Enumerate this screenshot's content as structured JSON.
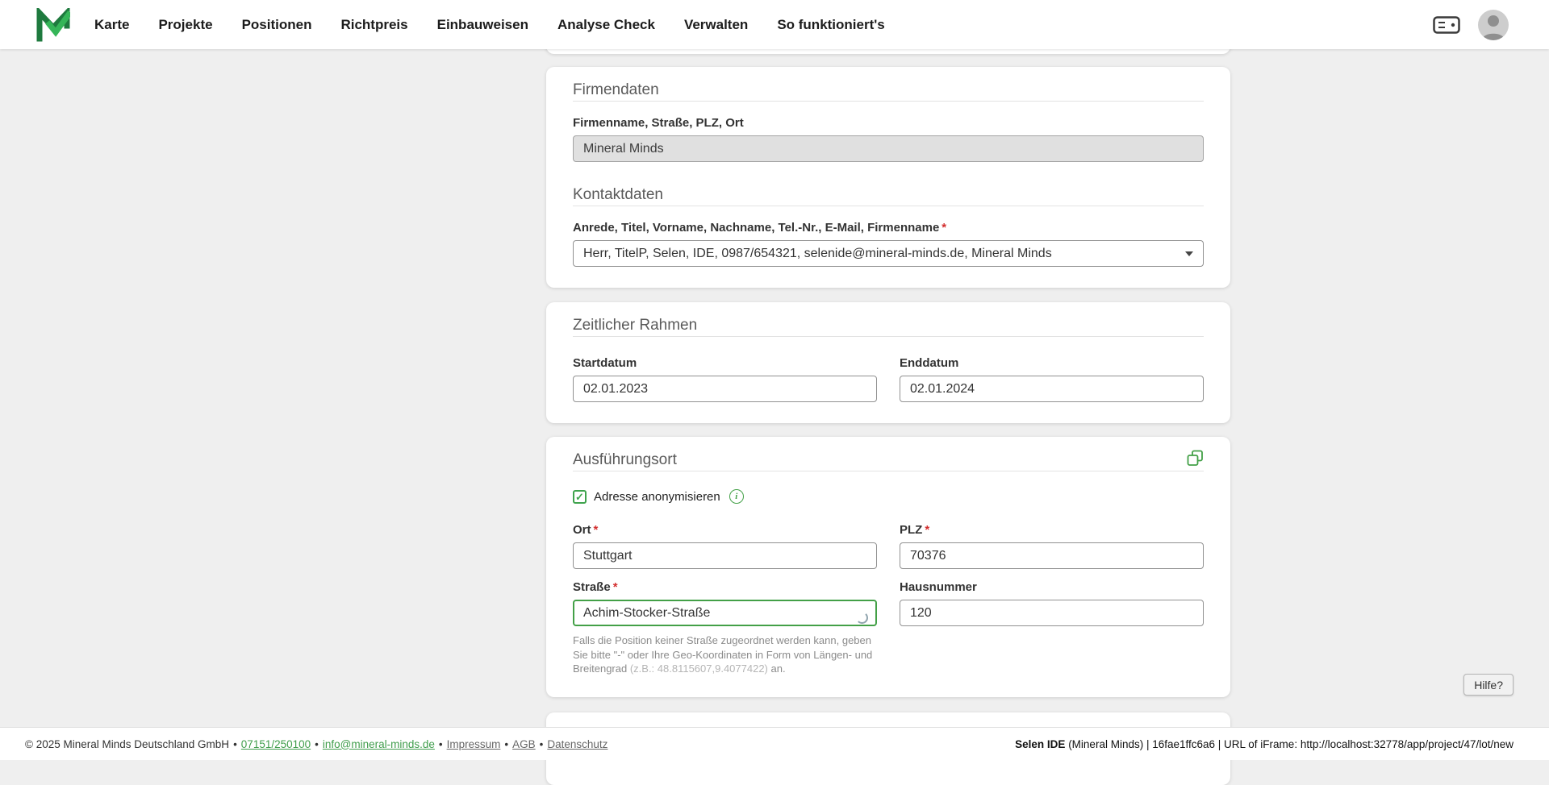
{
  "ui": {
    "required": "*",
    "check": "✓",
    "info": "i",
    "sep": "•"
  },
  "nav": {
    "items": [
      "Karte",
      "Projekte",
      "Positionen",
      "Richtpreis",
      "Einbauweisen",
      "Analyse Check",
      "Verwalten",
      "So funktioniert's"
    ]
  },
  "firmendaten": {
    "title": "Firmendaten",
    "address_label": "Firmenname, Straße, PLZ, Ort",
    "address_value": "Mineral Minds",
    "kontakt_title": "Kontaktdaten",
    "kontakt_label": "Anrede, Titel, Vorname, Nachname, Tel.-Nr., E-Mail, Firmenname",
    "kontakt_value": "Herr, TitelP, Selen, IDE, 0987/654321, selenide@mineral-minds.de, Mineral Minds"
  },
  "zeitraum": {
    "title": "Zeitlicher Rahmen",
    "start_label": "Startdatum",
    "start_value": "02.01.2023",
    "end_label": "Enddatum",
    "end_value": "02.01.2024"
  },
  "ausfuehrungsort": {
    "title": "Ausführungsort",
    "anonymize_label": "Adresse anonymisieren",
    "ort_label": "Ort",
    "ort_value": "Stuttgart",
    "plz_label": "PLZ",
    "plz_value": "70376",
    "strasse_label": "Straße",
    "strasse_value": "Achim-Stocker-Straße",
    "hausnummer_label": "Hausnummer",
    "hausnummer_value": "120",
    "hint_text": "Falls die Position keiner Straße zugeordnet werden kann, geben Sie bitte \"-\" oder Ihre Geo-Koordinaten in Form von Längen- und Breitengrad ",
    "hint_example": "(z.B.: 48.8115607,9.4077422)",
    "hint_suffix": " an."
  },
  "help_button": "Hilfe?",
  "footer": {
    "copyright": "© 2025 Mineral Minds Deutschland GmbH",
    "phone": "07151/250100",
    "email": "info@mineral-minds.de",
    "impressum": "Impressum",
    "agb": "AGB",
    "datenschutz": "Datenschutz",
    "right_bold": "Selen IDE",
    "right_rest": " (Mineral Minds) | 16fae1ffc6a6 | URL of iFrame: http://localhost:32778/app/project/47/lot/new"
  }
}
